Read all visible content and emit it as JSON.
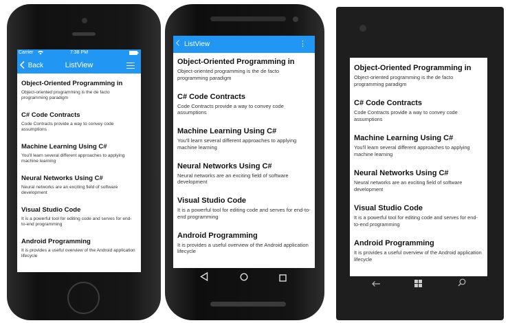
{
  "ios": {
    "status": {
      "carrier": "Carrier",
      "wifi_icon": "wifi-icon",
      "time": "7:38 PM"
    },
    "nav": {
      "back_label": "Back",
      "title": "ListView",
      "menu_icon": "hamburger-icon"
    }
  },
  "android": {
    "app_bar": {
      "title": "ListView",
      "back_icon": "chevron-left-icon",
      "overflow_icon": "more-vertical-icon"
    },
    "nav_keys": [
      "back-triangle-icon",
      "home-circle-icon",
      "recents-square-icon"
    ]
  },
  "windows": {
    "nav_keys": [
      "back-arrow-icon",
      "windows-logo-icon",
      "search-icon"
    ]
  },
  "list_items": [
    {
      "title": "Object-Oriented Programming in",
      "desc": "Object-oriented programming is the de facto programming paradigm"
    },
    {
      "title": "C# Code Contracts",
      "desc": "Code Contracts provide a way to convey code assumptions"
    },
    {
      "title": "Machine Learning Using C#",
      "desc": "You'll learn several different approaches to applying machine learning"
    },
    {
      "title": "Neural Networks Using C#",
      "desc": "Neural networks are an exciting field of software development"
    },
    {
      "title": "Visual Studio Code",
      "desc": "It is a powerful tool for editing code and serves for end-to-end programming"
    },
    {
      "title": "Android Programming",
      "desc": "It is provides a useful overview of the Android application lifecycle"
    }
  ],
  "colors": {
    "accent": "#2196F3",
    "text": "#111111"
  }
}
